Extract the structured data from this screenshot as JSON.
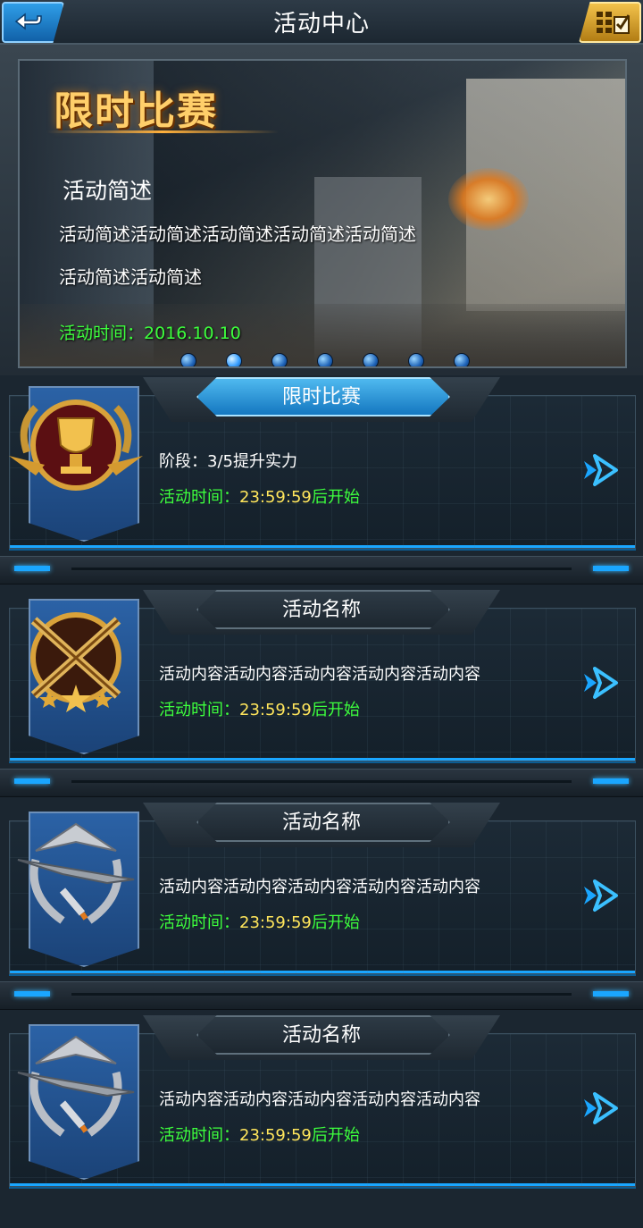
{
  "header": {
    "title": "活动中心"
  },
  "banner": {
    "title": "限时比赛",
    "heading": "活动简述",
    "lines": [
      "活动简述活动简述活动简述活动简述活动简述",
      "活动简述活动简述"
    ],
    "time": "活动时间：2016.10.10",
    "page_count": 7,
    "active_page": 2
  },
  "events": [
    {
      "name": "限时比赛",
      "content": "阶段：3/5提升实力",
      "time_prefix": "活动时间：",
      "time_clock": "23:59:59",
      "time_suffix": "后开始",
      "medal_icon": "trophy-medal-icon",
      "active": true
    },
    {
      "name": "活动名称",
      "content": "活动内容活动内容活动内容活动内容活动内容",
      "time_prefix": "活动时间：",
      "time_clock": "23:59:59",
      "time_suffix": "后开始",
      "medal_icon": "crossed-rifles-medal-icon",
      "active": false
    },
    {
      "name": "活动名称",
      "content": "活动内容活动内容活动内容活动内容活动内容",
      "time_prefix": "活动时间：",
      "time_clock": "23:59:59",
      "time_suffix": "后开始",
      "medal_icon": "jet-wreath-medal-icon",
      "active": false
    },
    {
      "name": "活动名称",
      "content": "活动内容活动内容活动内容活动内容活动内容",
      "time_prefix": "活动时间：",
      "time_clock": "23:59:59",
      "time_suffix": "后开始",
      "medal_icon": "jet-wreath-medal-icon",
      "active": false
    }
  ],
  "colors": {
    "accent_blue": "#1aa6ff",
    "time_green": "#3dff3d",
    "clock_yellow": "#ffe65c",
    "title_gold": "#ffcf6a"
  }
}
